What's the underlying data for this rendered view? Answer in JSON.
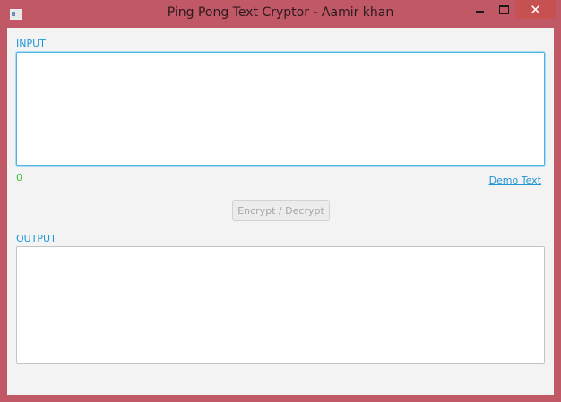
{
  "window": {
    "title": "Ping Pong Text Cryptor - Aamir khan",
    "controls": {
      "minimize": "minimize",
      "maximize": "maximize",
      "close": "✕"
    }
  },
  "input": {
    "label": "INPUT",
    "value": "",
    "char_count": "0",
    "demo_link": "Demo Text"
  },
  "action": {
    "label": "Encrypt / Decrypt",
    "enabled": false
  },
  "output": {
    "label": "OUTPUT",
    "value": ""
  },
  "colors": {
    "frame": "#c05865",
    "accent": "#1f97d4",
    "counter": "#3cc13c",
    "close_button": "#c75050"
  }
}
